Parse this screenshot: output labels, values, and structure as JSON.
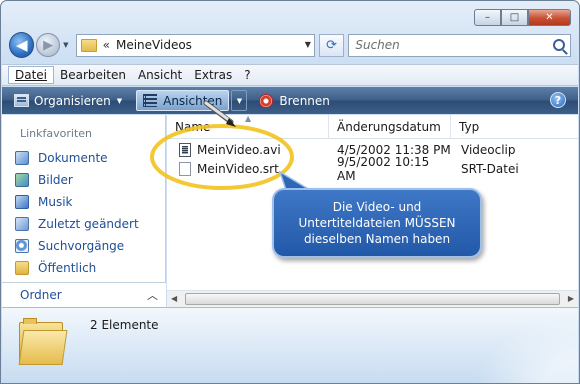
{
  "window": {
    "caption_min": "–",
    "caption_max": "□",
    "caption_close": "✕"
  },
  "address": {
    "chevron": "«",
    "path": "MeineVideos"
  },
  "search": {
    "placeholder": "Suchen"
  },
  "menu": [
    "Datei",
    "Bearbeiten",
    "Ansicht",
    "Extras",
    "?"
  ],
  "toolbar": {
    "organize": "Organisieren",
    "views": "Ansichten",
    "burn": "Brennen",
    "help": "?"
  },
  "favorites": {
    "header": "Linkfavoriten",
    "items": [
      "Dokumente",
      "Bilder",
      "Musik",
      "Zuletzt geändert",
      "Suchvorgänge",
      "Öffentlich"
    ]
  },
  "folders_label": "Ordner",
  "columns": {
    "name": "Name",
    "date": "Änderungsdatum",
    "type": "Typ"
  },
  "files": [
    {
      "name": "MeinVideo.avi",
      "date": "4/5/2002 11:38 PM",
      "type": "Videoclip",
      "icon": "video-file-icon"
    },
    {
      "name": "MeinVideo.srt",
      "date": "9/5/2002 10:15 AM",
      "type": "SRT-Datei",
      "icon": "text-file-icon"
    }
  ],
  "details": {
    "count": "2 Elemente"
  },
  "callout": {
    "text": "Die Video- und Untertiteldateien MÜSSEN dieselben Namen haben"
  },
  "colors": {
    "callout_bg": "#2d63b2",
    "highlight_ellipse": "#f3c21c",
    "link_text": "#1f4f96",
    "toolbar_bg": "#3c5d86"
  }
}
